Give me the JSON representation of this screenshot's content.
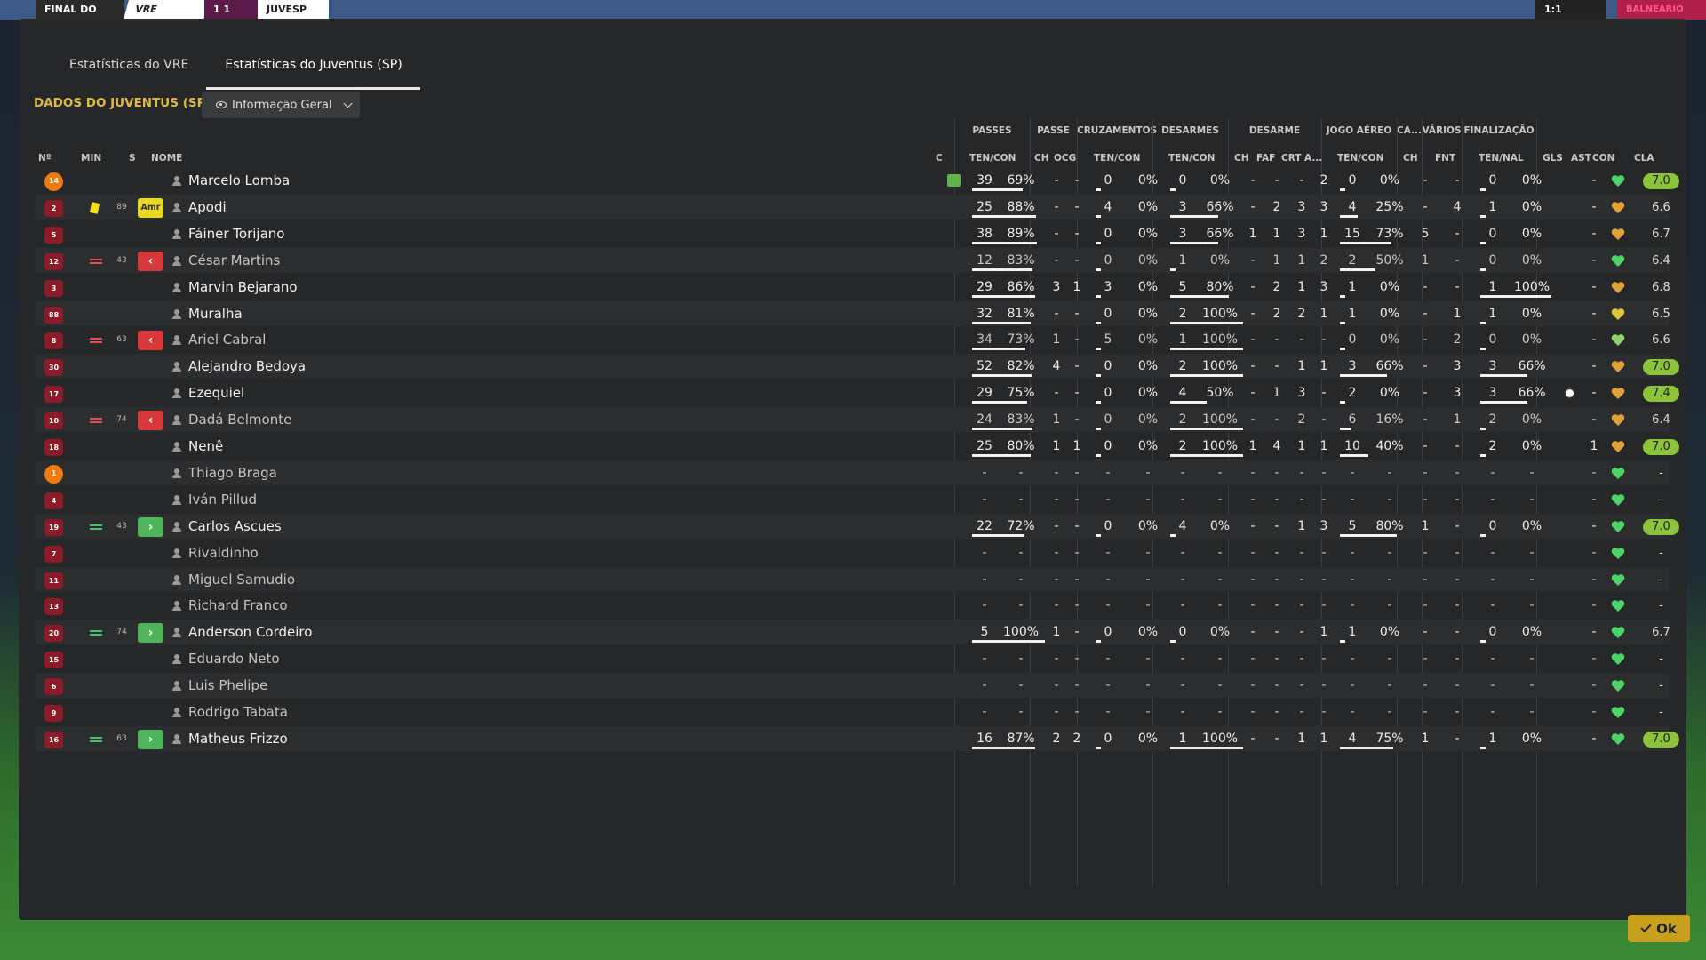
{
  "topbar": {
    "final": "FINAL DO",
    "home": "VRE",
    "score": "1 1",
    "away": "JUVESP",
    "right_score": "1:1",
    "balneario": "BALNEÁRIO"
  },
  "tabs": [
    {
      "label": "Estatísticas do VRE",
      "active": false
    },
    {
      "label": "Estatísticas do Juventus (SP)",
      "active": true
    }
  ],
  "section_title": "DADOS DO JUVENTUS (SP)",
  "view_select": {
    "label": "Informação Geral"
  },
  "group_headers": [
    "PASSES",
    "PASSE",
    "CRUZAMENTOS",
    "DESARMES",
    "DESARME",
    "JOGO AÉREO",
    "CA...",
    "VÁRIOS",
    "FINALIZAÇÃO"
  ],
  "columns": {
    "no": "Nº",
    "min": "MIN",
    "s": "S",
    "nome": "NOME",
    "c": "C",
    "pass_tencon": "TEN/CON",
    "pass_ch": "CH",
    "pass_ocg": "OCG",
    "cruz_tencon": "TEN/CON",
    "des_tencon": "TEN/CON",
    "d_ch": "CH",
    "d_faf": "FAF",
    "d_crt": "CRT",
    "d_a": "A...",
    "aer_tencon": "TEN/CON",
    "ca_ch": "CH",
    "fnt": "FNT",
    "fin_tennal": "TEN/NAL",
    "gls": "GLS",
    "ast": "AST",
    "con": "CON",
    "cla": "CLA"
  },
  "players": [
    {
      "no": "14",
      "gk": true,
      "min": "",
      "s": "",
      "name": "Marcelo Lomba",
      "sub": "",
      "c": true,
      "pass": [
        "39",
        "69%"
      ],
      "pch": "-",
      "pocg": "-",
      "cruz": [
        "0",
        "0%"
      ],
      "des": [
        "0",
        "0%"
      ],
      "dch": "-",
      "faf": "-",
      "crt": "-",
      "a": "2",
      "aer": [
        "0",
        "0%"
      ],
      "cach": "-",
      "fnt": "-",
      "fin": [
        "0",
        "0%"
      ],
      "gls": "",
      "ast": "-",
      "con": "green",
      "cla": "7.0",
      "cla_hi": true,
      "dim": false,
      "bars": {
        "pass": 0.69,
        "cruz": 0,
        "des": 0,
        "aer": 0,
        "fin": 0
      }
    },
    {
      "no": "2",
      "min": "89",
      "s": "Amr",
      "name": "Apodi",
      "sub": "yellow",
      "pass": [
        "25",
        "88%"
      ],
      "pch": "-",
      "pocg": "-",
      "cruz": [
        "4",
        "0%"
      ],
      "des": [
        "3",
        "66%"
      ],
      "dch": "-",
      "faf": "2",
      "crt": "3",
      "a": "3",
      "aer": [
        "4",
        "25%"
      ],
      "cach": "-",
      "fnt": "4",
      "fin": [
        "1",
        "0%"
      ],
      "gls": "",
      "ast": "-",
      "con": "orange",
      "cla": "6.6",
      "cla_hi": false,
      "dim": false,
      "bars": {
        "pass": 0.88,
        "cruz": 0,
        "des": 0.66,
        "aer": 0.25,
        "fin": 0
      }
    },
    {
      "no": "5",
      "min": "",
      "s": "",
      "name": "Fáiner Torijano",
      "sub": "",
      "pass": [
        "38",
        "89%"
      ],
      "pch": "-",
      "pocg": "-",
      "cruz": [
        "0",
        "0%"
      ],
      "des": [
        "3",
        "66%"
      ],
      "dch": "1",
      "faf": "1",
      "crt": "3",
      "a": "1",
      "aer": [
        "15",
        "73%"
      ],
      "cach": "5",
      "fnt": "-",
      "fin": [
        "0",
        "0%"
      ],
      "gls": "",
      "ast": "-",
      "con": "orange",
      "cla": "6.7",
      "cla_hi": false,
      "dim": false,
      "bars": {
        "pass": 0.89,
        "cruz": 0,
        "des": 0.66,
        "aer": 0.73,
        "fin": 0
      }
    },
    {
      "no": "12",
      "min": "43",
      "s": "out",
      "name": "César Martins",
      "sub": "out",
      "pass": [
        "12",
        "83%"
      ],
      "pch": "-",
      "pocg": "-",
      "cruz": [
        "0",
        "0%"
      ],
      "des": [
        "1",
        "0%"
      ],
      "dch": "-",
      "faf": "1",
      "crt": "1",
      "a": "2",
      "aer": [
        "2",
        "50%"
      ],
      "cach": "1",
      "fnt": "-",
      "fin": [
        "0",
        "0%"
      ],
      "gls": "",
      "ast": "-",
      "con": "green",
      "cla": "6.4",
      "cla_hi": false,
      "dim": true,
      "bars": {
        "pass": 0.83,
        "cruz": 0,
        "des": 0,
        "aer": 0.5,
        "fin": 0
      }
    },
    {
      "no": "3",
      "min": "",
      "s": "",
      "name": "Marvin Bejarano",
      "sub": "",
      "pass": [
        "29",
        "86%"
      ],
      "pch": "3",
      "pocg": "1",
      "cruz": [
        "3",
        "0%"
      ],
      "des": [
        "5",
        "80%"
      ],
      "dch": "-",
      "faf": "2",
      "crt": "1",
      "a": "3",
      "aer": [
        "1",
        "0%"
      ],
      "cach": "-",
      "fnt": "-",
      "fin": [
        "1",
        "100%"
      ],
      "gls": "",
      "ast": "-",
      "con": "orange",
      "cla": "6.8",
      "cla_hi": false,
      "dim": false,
      "bars": {
        "pass": 0.86,
        "cruz": 0,
        "des": 0.8,
        "aer": 0,
        "fin": 1
      }
    },
    {
      "no": "88",
      "min": "",
      "s": "",
      "name": "Muralha",
      "sub": "",
      "pass": [
        "32",
        "81%"
      ],
      "pch": "-",
      "pocg": "-",
      "cruz": [
        "0",
        "0%"
      ],
      "des": [
        "2",
        "100%"
      ],
      "dch": "-",
      "faf": "2",
      "crt": "2",
      "a": "1",
      "aer": [
        "1",
        "0%"
      ],
      "cach": "-",
      "fnt": "1",
      "fin": [
        "1",
        "0%"
      ],
      "gls": "",
      "ast": "-",
      "con": "yellow",
      "cla": "6.5",
      "cla_hi": false,
      "dim": false,
      "bars": {
        "pass": 0.81,
        "cruz": 0,
        "des": 1,
        "aer": 0,
        "fin": 0
      }
    },
    {
      "no": "8",
      "min": "63",
      "s": "out",
      "name": "Ariel Cabral",
      "sub": "out",
      "pass": [
        "34",
        "73%"
      ],
      "pch": "1",
      "pocg": "-",
      "cruz": [
        "5",
        "0%"
      ],
      "des": [
        "1",
        "100%"
      ],
      "dch": "-",
      "faf": "-",
      "crt": "-",
      "a": "-",
      "aer": [
        "0",
        "0%"
      ],
      "cach": "-",
      "fnt": "2",
      "fin": [
        "0",
        "0%"
      ],
      "gls": "",
      "ast": "-",
      "con": "light",
      "cla": "6.6",
      "cla_hi": false,
      "dim": true,
      "bars": {
        "pass": 0.73,
        "cruz": 0,
        "des": 1,
        "aer": 0,
        "fin": 0
      }
    },
    {
      "no": "30",
      "min": "",
      "s": "",
      "name": "Alejandro Bedoya",
      "sub": "",
      "pass": [
        "52",
        "82%"
      ],
      "pch": "4",
      "pocg": "-",
      "cruz": [
        "0",
        "0%"
      ],
      "des": [
        "2",
        "100%"
      ],
      "dch": "-",
      "faf": "-",
      "crt": "1",
      "a": "1",
      "aer": [
        "3",
        "66%"
      ],
      "cach": "-",
      "fnt": "3",
      "fin": [
        "3",
        "66%"
      ],
      "gls": "",
      "ast": "-",
      "con": "orange",
      "cla": "7.0",
      "cla_hi": true,
      "dim": false,
      "bars": {
        "pass": 0.82,
        "cruz": 0,
        "des": 1,
        "aer": 0.66,
        "fin": 0.66
      }
    },
    {
      "no": "17",
      "min": "",
      "s": "",
      "name": "Ezequiel",
      "sub": "",
      "pass": [
        "29",
        "75%"
      ],
      "pch": "-",
      "pocg": "-",
      "cruz": [
        "0",
        "0%"
      ],
      "des": [
        "4",
        "50%"
      ],
      "dch": "-",
      "faf": "1",
      "crt": "3",
      "a": "-",
      "aer": [
        "2",
        "0%"
      ],
      "cach": "-",
      "fnt": "3",
      "fin": [
        "3",
        "66%"
      ],
      "gls": "ball",
      "ast": "-",
      "con": "orange",
      "cla": "7.4",
      "cla_hi": true,
      "dim": false,
      "bars": {
        "pass": 0.75,
        "cruz": 0,
        "des": 0.5,
        "aer": 0,
        "fin": 0.66
      }
    },
    {
      "no": "10",
      "min": "74",
      "s": "out",
      "name": "Dadá Belmonte",
      "sub": "out",
      "pass": [
        "24",
        "83%"
      ],
      "pch": "1",
      "pocg": "-",
      "cruz": [
        "0",
        "0%"
      ],
      "des": [
        "2",
        "100%"
      ],
      "dch": "-",
      "faf": "-",
      "crt": "2",
      "a": "-",
      "aer": [
        "6",
        "16%"
      ],
      "cach": "-",
      "fnt": "1",
      "fin": [
        "2",
        "0%"
      ],
      "gls": "",
      "ast": "-",
      "con": "orange",
      "cla": "6.4",
      "cla_hi": false,
      "dim": true,
      "bars": {
        "pass": 0.83,
        "cruz": 0,
        "des": 1,
        "aer": 0.16,
        "fin": 0
      }
    },
    {
      "no": "18",
      "min": "",
      "s": "",
      "name": "Nenê",
      "sub": "",
      "pass": [
        "25",
        "80%"
      ],
      "pch": "1",
      "pocg": "1",
      "cruz": [
        "0",
        "0%"
      ],
      "des": [
        "2",
        "100%"
      ],
      "dch": "1",
      "faf": "4",
      "crt": "1",
      "a": "1",
      "aer": [
        "10",
        "40%"
      ],
      "cach": "-",
      "fnt": "-",
      "fin": [
        "2",
        "0%"
      ],
      "gls": "",
      "ast": "1",
      "con": "orange",
      "cla": "7.0",
      "cla_hi": true,
      "dim": false,
      "bars": {
        "pass": 0.8,
        "cruz": 0,
        "des": 1,
        "aer": 0.4,
        "fin": 0
      }
    },
    {
      "no": "1",
      "gk": true,
      "min": "",
      "s": "",
      "name": "Thiago Braga",
      "sub": "",
      "empty": true,
      "con": "green",
      "cla": "-",
      "dim": true
    },
    {
      "no": "4",
      "min": "",
      "s": "",
      "name": "Iván Pillud",
      "sub": "",
      "empty": true,
      "con": "green",
      "cla": "-",
      "dim": true
    },
    {
      "no": "19",
      "min": "43",
      "s": "in",
      "name": "Carlos Ascues",
      "sub": "in",
      "pass": [
        "22",
        "72%"
      ],
      "pch": "-",
      "pocg": "-",
      "cruz": [
        "0",
        "0%"
      ],
      "des": [
        "4",
        "0%"
      ],
      "dch": "-",
      "faf": "-",
      "crt": "1",
      "a": "3",
      "aer": [
        "5",
        "80%"
      ],
      "cach": "1",
      "fnt": "-",
      "fin": [
        "0",
        "0%"
      ],
      "gls": "",
      "ast": "-",
      "con": "green",
      "cla": "7.0",
      "cla_hi": true,
      "dim": false,
      "bars": {
        "pass": 0.72,
        "cruz": 0,
        "des": 0,
        "aer": 0.8,
        "fin": 0
      }
    },
    {
      "no": "7",
      "min": "",
      "s": "",
      "name": "Rivaldinho",
      "sub": "",
      "empty": true,
      "con": "green",
      "cla": "-",
      "dim": true
    },
    {
      "no": "11",
      "min": "",
      "s": "",
      "name": "Miguel Samudio",
      "sub": "",
      "empty": true,
      "con": "green",
      "cla": "-",
      "dim": true
    },
    {
      "no": "13",
      "min": "",
      "s": "",
      "name": "Richard Franco",
      "sub": "",
      "empty": true,
      "con": "green",
      "cla": "-",
      "dim": true
    },
    {
      "no": "20",
      "min": "74",
      "s": "in",
      "name": "Anderson Cordeiro",
      "sub": "in",
      "pass": [
        "5",
        "100%"
      ],
      "pch": "1",
      "pocg": "-",
      "cruz": [
        "0",
        "0%"
      ],
      "des": [
        "0",
        "0%"
      ],
      "dch": "-",
      "faf": "-",
      "crt": "-",
      "a": "1",
      "aer": [
        "1",
        "0%"
      ],
      "cach": "-",
      "fnt": "-",
      "fin": [
        "0",
        "0%"
      ],
      "gls": "",
      "ast": "-",
      "con": "green",
      "cla": "6.7",
      "cla_hi": false,
      "dim": false,
      "bars": {
        "pass": 1,
        "cruz": 0,
        "des": 0,
        "aer": 0,
        "fin": 0
      }
    },
    {
      "no": "15",
      "min": "",
      "s": "",
      "name": "Eduardo Neto",
      "sub": "",
      "empty": true,
      "con": "green",
      "cla": "-",
      "dim": true
    },
    {
      "no": "6",
      "min": "",
      "s": "",
      "name": "Luis Phelipe",
      "sub": "",
      "empty": true,
      "con": "green",
      "cla": "-",
      "dim": true
    },
    {
      "no": "9",
      "min": "",
      "s": "",
      "name": "Rodrigo Tabata",
      "sub": "",
      "empty": true,
      "con": "green",
      "cla": "-",
      "dim": true
    },
    {
      "no": "16",
      "min": "63",
      "s": "in",
      "name": "Matheus Frizzo",
      "sub": "in",
      "pass": [
        "16",
        "87%"
      ],
      "pch": "2",
      "pocg": "2",
      "cruz": [
        "0",
        "0%"
      ],
      "des": [
        "1",
        "100%"
      ],
      "dch": "-",
      "faf": "-",
      "crt": "1",
      "a": "1",
      "aer": [
        "4",
        "75%"
      ],
      "cach": "1",
      "fnt": "-",
      "fin": [
        "1",
        "0%"
      ],
      "gls": "",
      "ast": "-",
      "con": "green",
      "cla": "7.0",
      "cla_hi": true,
      "dim": false,
      "bars": {
        "pass": 0.87,
        "cruz": 0,
        "des": 1,
        "aer": 0.75,
        "fin": 0
      }
    }
  ],
  "ok_button": "Ok",
  "colors": {
    "accent": "#e0b848",
    "ok": "#c9a01e",
    "rating_hi": "#8bc33a",
    "number_badge": "#8b1b27",
    "gk_badge": "#f07a10"
  }
}
